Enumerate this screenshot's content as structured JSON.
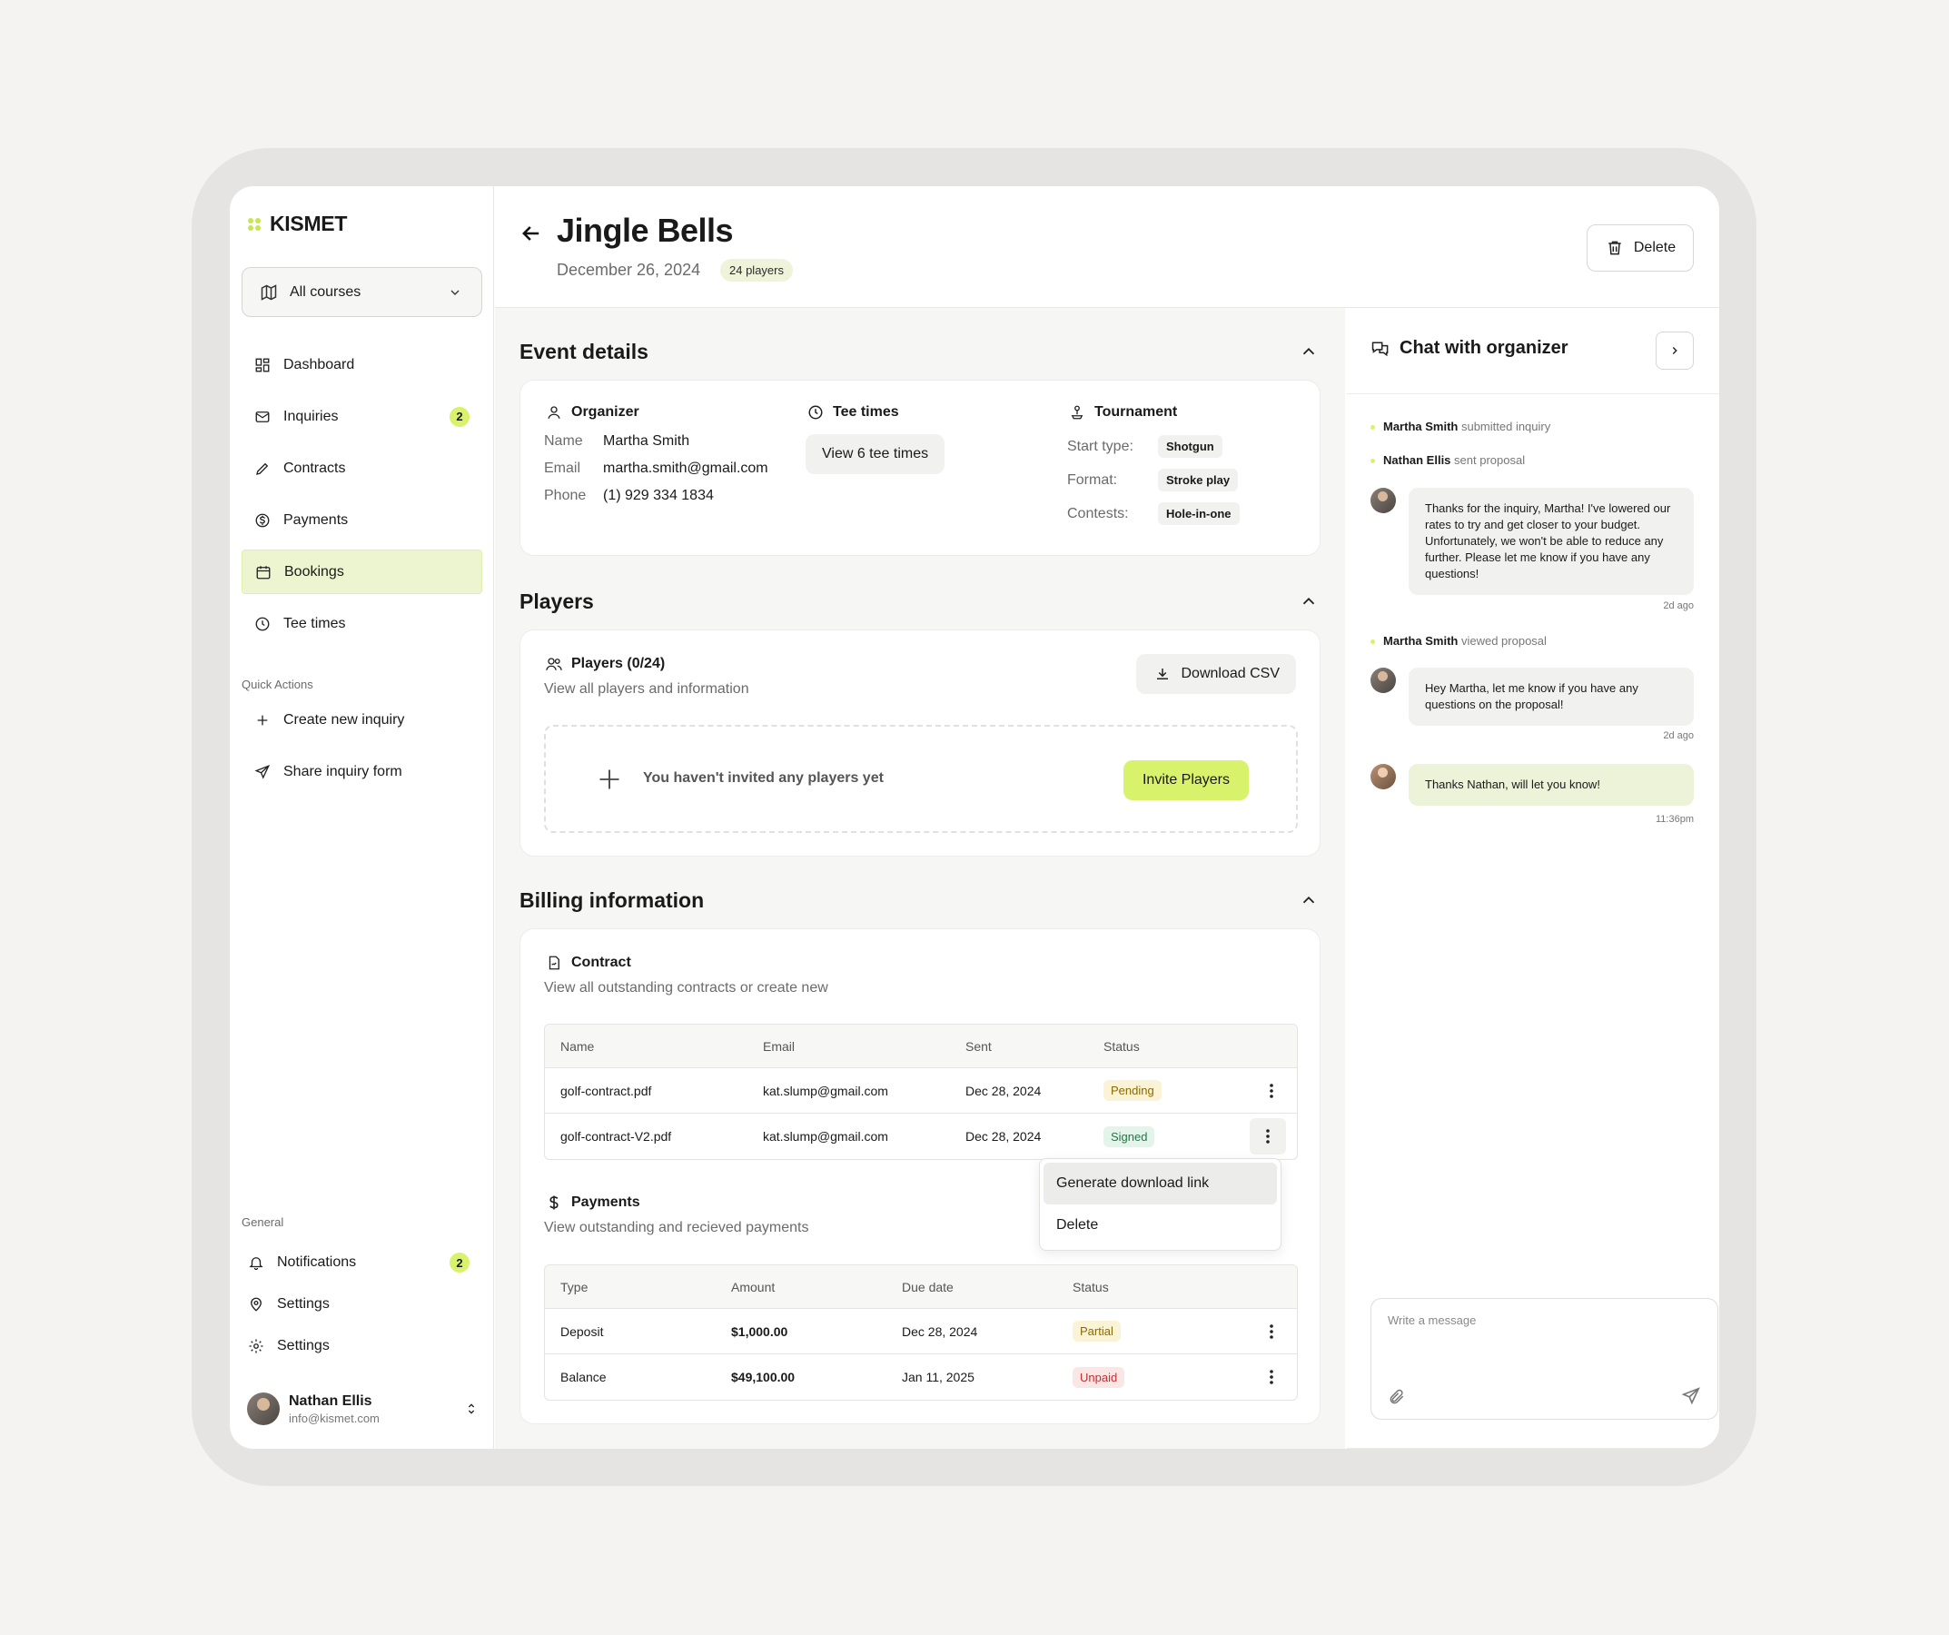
{
  "app": {
    "logo": "KISMET",
    "accent": "#d8f26b"
  },
  "sidebar": {
    "course_select": "All courses",
    "nav": [
      {
        "label": "Dashboard",
        "icon": "grid-icon"
      },
      {
        "label": "Inquiries",
        "icon": "mail-icon",
        "badge": "2"
      },
      {
        "label": "Contracts",
        "icon": "pen-icon"
      },
      {
        "label": "Payments",
        "icon": "dollar-circle-icon"
      },
      {
        "label": "Bookings",
        "icon": "calendar-icon",
        "active": true
      },
      {
        "label": "Tee times",
        "icon": "clock-icon"
      }
    ],
    "quick_actions_label": "Quick Actions",
    "quick_actions": [
      {
        "label": "Create new inquiry",
        "icon": "plus-icon"
      },
      {
        "label": "Share inquiry form",
        "icon": "send-icon"
      }
    ],
    "general_label": "General",
    "general": [
      {
        "label": "Notifications",
        "icon": "bell-icon",
        "badge": "2"
      },
      {
        "label": "Settings",
        "icon": "map-pin-icon"
      },
      {
        "label": "Settings",
        "icon": "gear-icon"
      }
    ],
    "user": {
      "name": "Nathan Ellis",
      "email": "info@kismet.com"
    }
  },
  "header": {
    "title": "Jingle Bells",
    "date": "December 26, 2024",
    "players_pill": "24 players",
    "delete_label": "Delete"
  },
  "event_details": {
    "title": "Event details",
    "organizer": {
      "heading": "Organizer",
      "name_label": "Name",
      "name": "Martha Smith",
      "email_label": "Email",
      "email": "martha.smith@gmail.com",
      "phone_label": "Phone",
      "phone": "(1) 929 334 1834"
    },
    "tee_times": {
      "heading": "Tee times",
      "button": "View 6 tee times"
    },
    "tournament": {
      "heading": "Tournament",
      "start_label": "Start type:",
      "start": "Shotgun",
      "format_label": "Format:",
      "format": "Stroke play",
      "contests_label": "Contests:",
      "contests": "Hole-in-one"
    }
  },
  "players": {
    "title": "Players",
    "heading": "Players (0/24)",
    "subtitle": "View all players and information",
    "download": "Download CSV",
    "empty": "You haven't invited any players yet",
    "invite": "Invite Players"
  },
  "billing": {
    "title": "Billing information",
    "contract": {
      "heading": "Contract",
      "subtitle": "View all outstanding contracts or create new",
      "columns": [
        "Name",
        "Email",
        "Sent",
        "Status"
      ],
      "rows": [
        {
          "name": "golf-contract.pdf",
          "email": "kat.slump@gmail.com",
          "sent": "Dec 28, 2024",
          "status": "Pending"
        },
        {
          "name": "golf-contract-V2.pdf",
          "email": "kat.slump@gmail.com",
          "sent": "Dec 28, 2024",
          "status": "Signed"
        }
      ]
    },
    "menu": {
      "items": [
        "Generate download link",
        "Delete"
      ]
    },
    "payments": {
      "heading": "Payments",
      "subtitle": "View outstanding and recieved payments",
      "columns": [
        "Type",
        "Amount",
        "Due date",
        "Status"
      ],
      "rows": [
        {
          "type": "Deposit",
          "amount": "$1,000.00",
          "due": "Dec 28, 2024",
          "status": "Partial"
        },
        {
          "type": "Balance",
          "amount": "$49,100.00",
          "due": "Jan 11, 2025",
          "status": "Unpaid"
        }
      ]
    }
  },
  "chat": {
    "title": "Chat with organizer",
    "events": [
      {
        "name": "Martha Smith",
        "text": "submitted inquiry"
      },
      {
        "name": "Nathan Ellis",
        "text": "sent proposal"
      },
      {
        "name": "Martha Smith",
        "text": "viewed proposal"
      }
    ],
    "messages": [
      {
        "text": "Thanks for the inquiry, Martha! I've lowered our rates to try and get closer to your budget. Unfortunately, we won't be able to reduce any further. Please let me know if you have any questions!",
        "time": "2d ago"
      },
      {
        "text": "Hey Martha, let me know if you have any questions on the proposal!",
        "time": "2d ago"
      },
      {
        "text": "Thanks Nathan, will let you know!",
        "time": "11:36pm"
      }
    ],
    "placeholder": "Write a message"
  }
}
